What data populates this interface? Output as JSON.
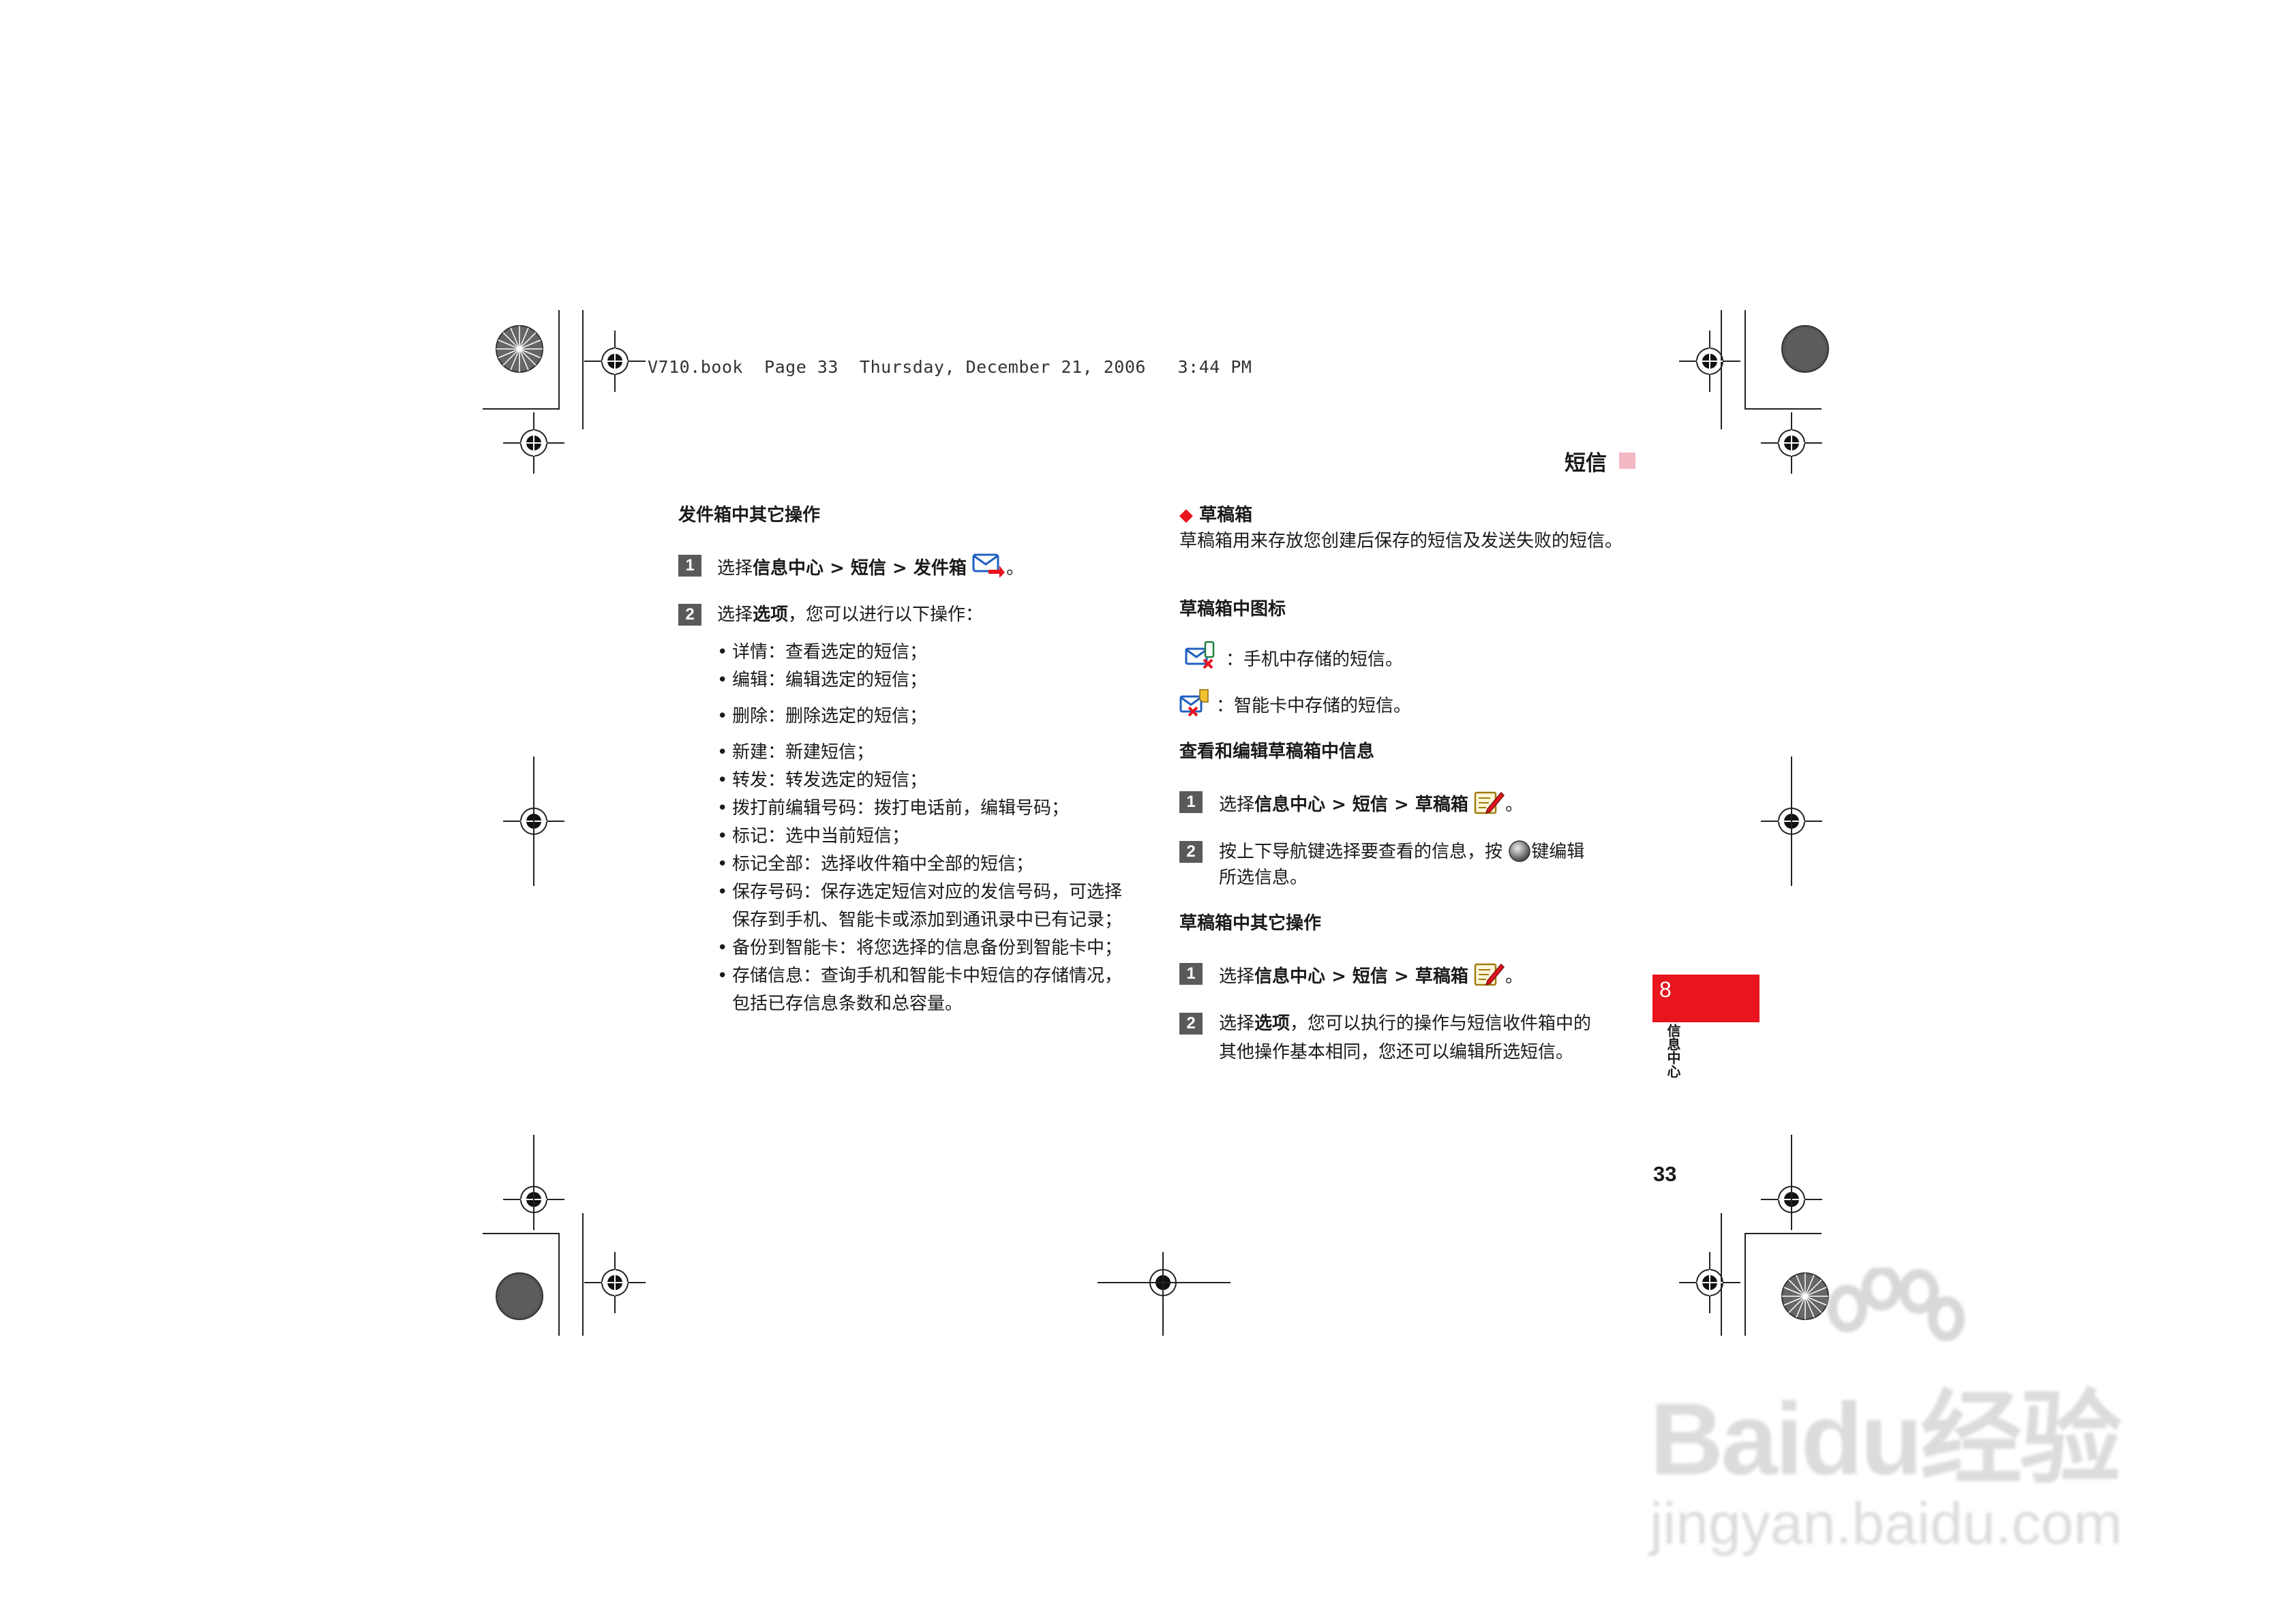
{
  "header": {
    "book": "V710.book",
    "page_label": "Page 33",
    "day": "Thursday,",
    "date": "December 21, 2006",
    "time": "3:44 PM"
  },
  "section_title": "短信",
  "left": {
    "heading": "发件箱中其它操作",
    "step1": {
      "num": "1",
      "pre": "选择",
      "a": "信息中心",
      "sep1": " > ",
      "b": "短信",
      "sep2": " > ",
      "c": "发件箱",
      "end": "。"
    },
    "step2": {
      "num": "2",
      "pre": "选择",
      "a": "选项",
      "rest": "，您可以进行以下操作："
    },
    "bullets": [
      "详情：查看选定的短信；",
      "编辑：编辑选定的短信；",
      "删除：删除选定的短信；",
      "新建：新建短信；",
      "转发：转发选定的短信；",
      "拨打前编辑号码：拨打电话前，编辑号码；",
      "标记：选中当前短信；",
      "标记全部：选择收件箱中全部的短信；",
      "保存号码：保存选定短信对应的发信号码，可选择保存到手机、智能卡或添加到通讯录中已有记录；",
      "备份到智能卡：将您选择的信息备份到智能卡中；",
      "存储信息：查询手机和智能卡中短信的存储情况，包括已存信息条数和总容量。"
    ]
  },
  "right": {
    "drafts_title": "草稿箱",
    "drafts_desc": "草稿箱用来存放您创建后保存的短信及发送失败的短信。",
    "icons_heading": "草稿箱中图标",
    "icon_phone_text": "：手机中存储的短信。",
    "icon_card_text": "：智能卡中存储的短信。",
    "view_heading": "查看和编辑草稿箱中信息",
    "v_step1": {
      "num": "1",
      "pre": "选择",
      "a": "信息中心",
      "sep1": " > ",
      "b": "短信",
      "sep2": " > ",
      "c": "草稿箱",
      "end": "。"
    },
    "v_step2": {
      "num": "2",
      "pre": "按上下导航键选择要查看的信息，按",
      "post": "键编辑",
      "line2": "所选信息。"
    },
    "other_heading": "草稿箱中其它操作",
    "o_step1": {
      "num": "1",
      "pre": "选择",
      "a": "信息中心",
      "sep1": " > ",
      "b": "短信",
      "sep2": " > ",
      "c": "草稿箱",
      "end": "。"
    },
    "o_step2": {
      "num": "2",
      "pre": "选择",
      "a": "选项",
      "rest": "，您可以执行的操作与短信收件箱中的",
      "line2": "其他操作基本相同，您还可以编辑所选短信。"
    }
  },
  "chapter": {
    "number": "8",
    "label": "信息中心"
  },
  "page_number": "33",
  "watermark": {
    "brand": "Baidu经验",
    "url": "jingyan.baidu.com"
  },
  "colors": {
    "chapter_red": "#e8141e",
    "title_pink": "#f4b8c4",
    "step_gray": "#5a5a5a",
    "diamond_red": "#e8141e"
  }
}
